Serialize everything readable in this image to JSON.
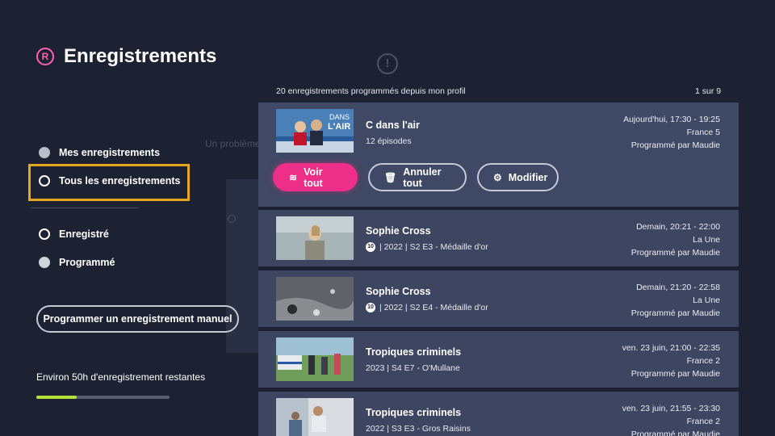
{
  "page": {
    "title": "Enregistrements",
    "title_icon": "registered-icon",
    "background_hint": "Un problème"
  },
  "filters": {
    "mes": "Mes enregistrements",
    "tous": "Tous les enregistrements",
    "enregistre": "Enregistré",
    "programme": "Programmé"
  },
  "manual_button": "Programmer un enregistrement manuel",
  "storage": {
    "label": "Environ 50h d'enregistrement restantes",
    "used_fraction": 0.3
  },
  "list": {
    "count_text": "20 enregistrements programmés depuis mon profil",
    "page_text": "1 sur 9"
  },
  "items": [
    {
      "title": "C dans l'air",
      "sub": "12 épisodes",
      "when": "Aujourd'hui, 17:30 - 19:25",
      "channel": "France 5",
      "by": "Programmé par Maudie",
      "thumb_text": "DANS L'AIR"
    },
    {
      "title": "Sophie Cross",
      "rating": "10",
      "sub": "| 2022  | S2 E3 - Médaille d'or",
      "when": "Demain, 20:21 - 22:00",
      "channel": "La Une",
      "by": "Programmé par Maudie"
    },
    {
      "title": "Sophie Cross",
      "rating": "10",
      "sub": "| 2022  | S2 E4 - Médaille d'or",
      "when": "Demain, 21:20 - 22:58",
      "channel": "La Une",
      "by": "Programmé par Maudie"
    },
    {
      "title": "Tropiques criminels",
      "sub": "2023  | S4 E7 - O'Mullane",
      "when": "ven. 23 juin, 21:00 - 22:35",
      "channel": "France 2",
      "by": "Programmé par Maudie"
    },
    {
      "title": "Tropiques criminels",
      "sub": "2022  | S3 E3 - Gros Raisins",
      "when": "ven. 23 juin, 21:55 - 23:30",
      "channel": "France 2",
      "by": "Programmé par Maudie"
    }
  ],
  "actions": {
    "voir": "Voir tout",
    "annuler": "Annuler tout",
    "modifier": "Modifier"
  },
  "colors": {
    "accent": "#ee2f87",
    "focus": "#e6a720",
    "progress": "#b3e23a",
    "background": "#1d2233",
    "card": "#3d4560"
  }
}
